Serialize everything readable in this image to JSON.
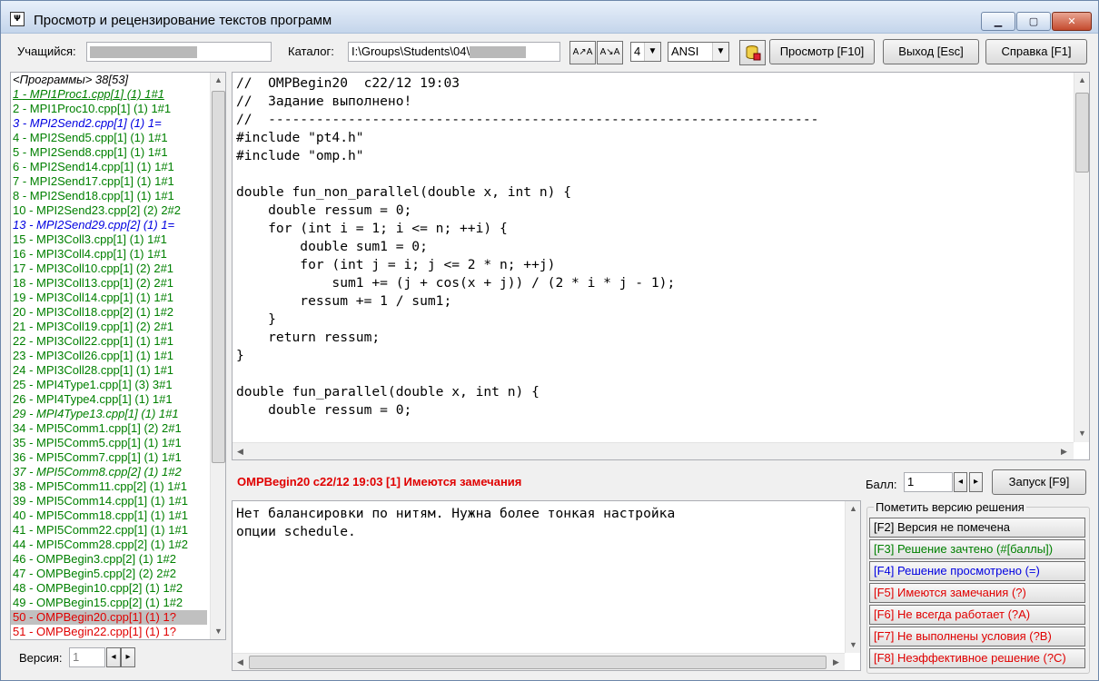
{
  "window": {
    "title": "Просмотр и рецензирование текстов программ",
    "min_glyph": "▁",
    "max_glyph": "▢",
    "close_glyph": "✕",
    "icon_text": "Ψ"
  },
  "toolbar": {
    "student_label": "Учащийся:",
    "catalog_label": "Каталог:",
    "catalog_value": "I:\\Groups\\Students\\04\\",
    "font_larger": "A↗A",
    "font_smaller": "A↘A",
    "tab_size": "4",
    "encoding": "ANSI",
    "view_button": "Просмотр [F10]",
    "exit_button": "Выход [Esc]",
    "help_button": "Справка [F1]"
  },
  "program_list": {
    "colors": {
      "green": "#008000",
      "blue": "#0000e0",
      "red": "#e00000",
      "selected_bg": "#c0c0c0"
    },
    "items": [
      {
        "text": "<Программы> 38[53]",
        "color": "#000000",
        "italic": true,
        "underline": false
      },
      {
        "text": "1 - MPI1Proc1.cpp[1] (1) 1#1",
        "color": "#008000",
        "italic": true,
        "underline": true
      },
      {
        "text": "2 - MPI1Proc10.cpp[1] (1) 1#1",
        "color": "#008000",
        "italic": false
      },
      {
        "text": "3 - MPI2Send2.cpp[1] (1) 1=",
        "color": "#0000e0",
        "italic": true
      },
      {
        "text": "4 - MPI2Send5.cpp[1] (1) 1#1",
        "color": "#008000",
        "italic": false
      },
      {
        "text": "5 - MPI2Send8.cpp[1] (1) 1#1",
        "color": "#008000",
        "italic": false
      },
      {
        "text": "6 - MPI2Send14.cpp[1] (1) 1#1",
        "color": "#008000",
        "italic": false
      },
      {
        "text": "7 - MPI2Send17.cpp[1] (1) 1#1",
        "color": "#008000",
        "italic": false
      },
      {
        "text": "8 - MPI2Send18.cpp[1] (1) 1#1",
        "color": "#008000",
        "italic": false
      },
      {
        "text": "10 - MPI2Send23.cpp[2] (2) 2#2",
        "color": "#008000",
        "italic": false
      },
      {
        "text": "13 - MPI2Send29.cpp[2] (1) 1=",
        "color": "#0000e0",
        "italic": true
      },
      {
        "text": "15 - MPI3Coll3.cpp[1] (1) 1#1",
        "color": "#008000",
        "italic": false
      },
      {
        "text": "16 - MPI3Coll4.cpp[1] (1) 1#1",
        "color": "#008000",
        "italic": false
      },
      {
        "text": "17 - MPI3Coll10.cpp[1] (2) 2#1",
        "color": "#008000",
        "italic": false
      },
      {
        "text": "18 - MPI3Coll13.cpp[1] (2) 2#1",
        "color": "#008000",
        "italic": false
      },
      {
        "text": "19 - MPI3Coll14.cpp[1] (1) 1#1",
        "color": "#008000",
        "italic": false
      },
      {
        "text": "20 - MPI3Coll18.cpp[2] (1) 1#2",
        "color": "#008000",
        "italic": false
      },
      {
        "text": "21 - MPI3Coll19.cpp[1] (2) 2#1",
        "color": "#008000",
        "italic": false
      },
      {
        "text": "22 - MPI3Coll22.cpp[1] (1) 1#1",
        "color": "#008000",
        "italic": false
      },
      {
        "text": "23 - MPI3Coll26.cpp[1] (1) 1#1",
        "color": "#008000",
        "italic": false
      },
      {
        "text": "24 - MPI3Coll28.cpp[1] (1) 1#1",
        "color": "#008000",
        "italic": false
      },
      {
        "text": "25 - MPI4Type1.cpp[1] (3) 3#1",
        "color": "#008000",
        "italic": false
      },
      {
        "text": "26 - MPI4Type4.cpp[1] (1) 1#1",
        "color": "#008000",
        "italic": false
      },
      {
        "text": "29 - MPI4Type13.cpp[1] (1) 1#1",
        "color": "#008000",
        "italic": true
      },
      {
        "text": "34 - MPI5Comm1.cpp[1] (2) 2#1",
        "color": "#008000",
        "italic": false
      },
      {
        "text": "35 - MPI5Comm5.cpp[1] (1) 1#1",
        "color": "#008000",
        "italic": false
      },
      {
        "text": "36 - MPI5Comm7.cpp[1] (1) 1#1",
        "color": "#008000",
        "italic": false
      },
      {
        "text": "37 - MPI5Comm8.cpp[2] (1) 1#2",
        "color": "#008000",
        "italic": true
      },
      {
        "text": "38 - MPI5Comm11.cpp[2] (1) 1#1",
        "color": "#008000",
        "italic": false
      },
      {
        "text": "39 - MPI5Comm14.cpp[1] (1) 1#1",
        "color": "#008000",
        "italic": false
      },
      {
        "text": "40 - MPI5Comm18.cpp[1] (1) 1#1",
        "color": "#008000",
        "italic": false
      },
      {
        "text": "41 - MPI5Comm22.cpp[1] (1) 1#1",
        "color": "#008000",
        "italic": false
      },
      {
        "text": "44 - MPI5Comm28.cpp[2] (1) 1#2",
        "color": "#008000",
        "italic": false
      },
      {
        "text": "46 - OMPBegin3.cpp[2] (1) 1#2",
        "color": "#008000",
        "italic": false
      },
      {
        "text": "47 - OMPBegin5.cpp[2] (2) 2#2",
        "color": "#008000",
        "italic": false
      },
      {
        "text": "48 - OMPBegin10.cpp[2] (1) 1#2",
        "color": "#008000",
        "italic": false
      },
      {
        "text": "49 - OMPBegin15.cpp[2] (1) 1#2",
        "color": "#008000",
        "italic": false
      },
      {
        "text": "50 - OMPBegin20.cpp[1] (1) 1?",
        "color": "#e00000",
        "italic": false,
        "selected": true
      },
      {
        "text": "51 - OMPBegin22.cpp[1] (1) 1?",
        "color": "#e00000",
        "italic": false
      }
    ],
    "version_label": "Версия:",
    "version_value": "1"
  },
  "editor": {
    "lines": [
      "//  OMPBegin20  c22/12 19:03",
      "//  Задание выполнено!",
      "//  ---------------------------------------------------------------------",
      "#include \"pt4.h\"",
      "#include \"omp.h\"",
      "",
      "double fun_non_parallel(double x, int n) {",
      "    double ressum = 0;",
      "    for (int i = 1; i <= n; ++i) {",
      "        double sum1 = 0;",
      "        for (int j = i; j <= 2 * n; ++j)",
      "            sum1 += (j + cos(x + j)) / (2 * i * j - 1);",
      "        ressum += 1 / sum1;",
      "    }",
      "    return ressum;",
      "}",
      "",
      "double fun_parallel(double x, int n) {",
      "    double ressum = 0;"
    ]
  },
  "review": {
    "status_text": "OMPBegin20  c22/12 19:03 [1] Имеются замечания",
    "status_color": "#e00000",
    "score_label": "Балл:",
    "score_value": "1",
    "run_button": "Запуск [F9]",
    "notes_lines": [
      "Нет балансировки по нитям. Нужна более тонкая настройка",
      "опции schedule."
    ]
  },
  "marks": {
    "group_title": "Пометить версию решения",
    "buttons": [
      {
        "label": "[F2] Версия не помечена",
        "color": "#000000"
      },
      {
        "label": "[F3] Решение зачтено (#[баллы])",
        "color": "#008000"
      },
      {
        "label": "[F4] Решение просмотрено (=)",
        "color": "#0000e0"
      },
      {
        "label": "[F5] Имеются замечания (?)",
        "color": "#e00000"
      },
      {
        "label": "[F6] Не всегда работает (?A)",
        "color": "#e00000"
      },
      {
        "label": "[F7] Не выполнены условия (?B)",
        "color": "#e00000"
      },
      {
        "label": "[F8] Неэффективное решение (?C)",
        "color": "#e00000"
      }
    ]
  }
}
